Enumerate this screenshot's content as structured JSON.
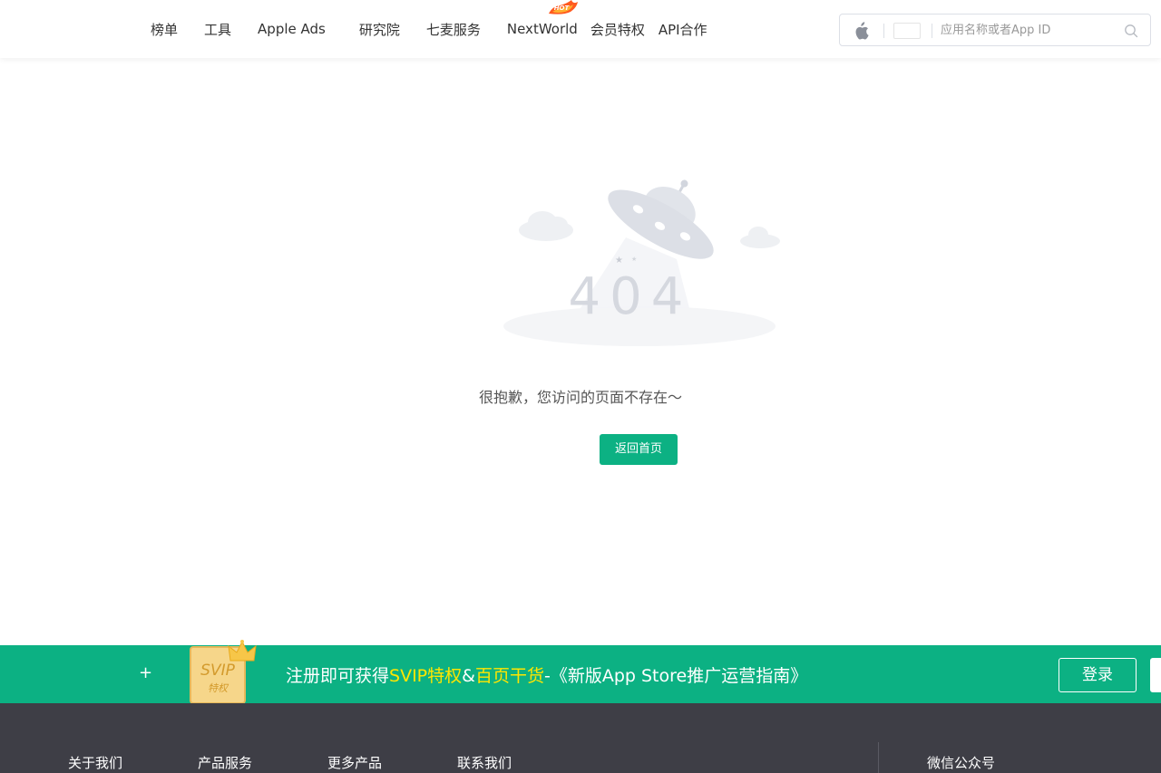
{
  "header": {
    "nav": [
      {
        "label": "榜单"
      },
      {
        "label": "工具"
      },
      {
        "label": "Apple Ads"
      },
      {
        "label": "研究院"
      },
      {
        "label": "七麦服务"
      },
      {
        "label": "NextWorld",
        "badge": "HOT"
      },
      {
        "label": "会员特权"
      },
      {
        "label": "API合作"
      }
    ],
    "search": {
      "platform_icon": "apple-icon",
      "placeholder": "应用名称或者App ID",
      "value": ""
    }
  },
  "main": {
    "illustration_text": "404",
    "message": "很抱歉，您访问的页面不存在～",
    "home_button": "返回首页"
  },
  "promo": {
    "plus": "+",
    "svip_badge": {
      "title": "SVIP",
      "subtitle": "特权"
    },
    "text_prefix": "注册即可获得",
    "text_highlight1": "SVIP特权",
    "text_amp": "&",
    "text_highlight2": "百页干货",
    "text_suffix": "-《新版App Store推广运营指南》",
    "login_button": "登录"
  },
  "footer": {
    "columns": [
      {
        "title": "关于我们"
      },
      {
        "title": "产品服务"
      },
      {
        "title": "更多产品"
      },
      {
        "title": "联系我们"
      }
    ],
    "wechat_title": "微信公众号"
  },
  "colors": {
    "accent": "#0cb183",
    "highlight": "#ffe600",
    "footer_bg": "#3e3e46"
  }
}
